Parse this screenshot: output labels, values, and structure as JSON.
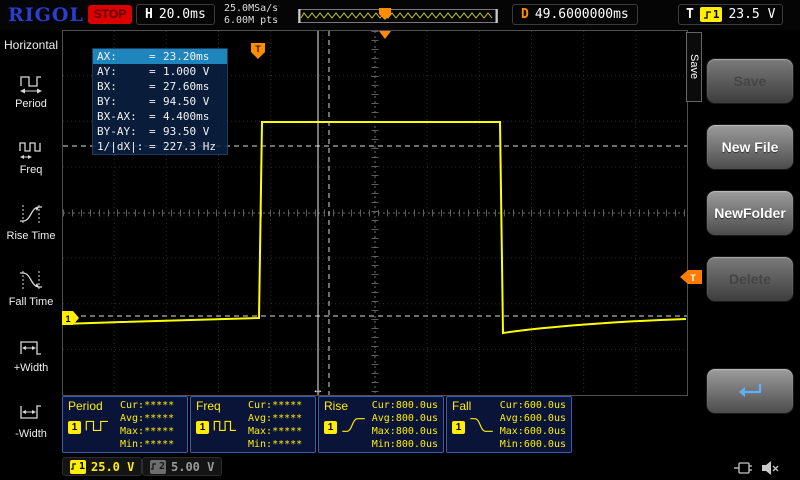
{
  "top_bar": {
    "logo": "RIGOL",
    "run_state": "STOP",
    "horizontal": {
      "label": "H",
      "timebase": "20.0ms"
    },
    "acquisition": {
      "sample_rate": "25.0MSa/s",
      "memory_depth": "6.00M pts"
    },
    "delay": {
      "label": "D",
      "value": "49.6000000ms"
    },
    "trigger": {
      "label": "T",
      "source": "1",
      "level": "23.5 V"
    }
  },
  "left_menu": {
    "title": "Horizontal",
    "items": [
      {
        "label": "Period"
      },
      {
        "label": "Freq"
      },
      {
        "label": "Rise Time"
      },
      {
        "label": "Fall Time"
      },
      {
        "label": "+Width"
      },
      {
        "label": "-Width"
      }
    ]
  },
  "cursor_panel": {
    "equals": "=",
    "rows": [
      {
        "label": "AX:",
        "value": "23.20ms"
      },
      {
        "label": "AY:",
        "value": "1.000 V"
      },
      {
        "label": "BX:",
        "value": "27.60ms"
      },
      {
        "label": "BY:",
        "value": "94.50 V"
      },
      {
        "label": "BX-AX:",
        "value": "4.400ms"
      },
      {
        "label": "BY-AY:",
        "value": "93.50 V"
      },
      {
        "label": "1/|dX|:",
        "value": "227.3 Hz"
      }
    ]
  },
  "right_menu": {
    "tab_label": "Save",
    "buttons": [
      {
        "label": "Save",
        "enabled": false
      },
      {
        "label": "New File",
        "enabled": true
      },
      {
        "label": "NewFolder",
        "enabled": true
      },
      {
        "label": "Delete",
        "enabled": false
      }
    ]
  },
  "measurements": {
    "stat_labels": {
      "cur": "Cur:",
      "avg": "Avg:",
      "max": "Max:",
      "min": "Min:"
    },
    "items": [
      {
        "name": "Period",
        "source": "1",
        "cur": "*****",
        "avg": "*****",
        "max": "*****",
        "min": "*****"
      },
      {
        "name": "Freq",
        "source": "1",
        "cur": "*****",
        "avg": "*****",
        "max": "*****",
        "min": "*****"
      },
      {
        "name": "Rise",
        "source": "1",
        "cur": "800.0us",
        "avg": "800.0us",
        "max": "800.0us",
        "min": "800.0us"
      },
      {
        "name": "Fall",
        "source": "1",
        "cur": "600.0us",
        "avg": "600.0us",
        "max": "600.0us",
        "min": "600.0us"
      }
    ]
  },
  "channel_bar": {
    "ch1": {
      "number": "1",
      "scale": "25.0 V"
    },
    "ch2": {
      "number": "2",
      "scale": "5.00 V"
    }
  },
  "icons": {
    "cursor_drag": "↔"
  },
  "colors": {
    "waveform": "#ffff00",
    "trigger_orange": "#ff8c00",
    "channel1_yellow": "#ffee00",
    "logo_blue": "#2a3ed2",
    "stop_red": "#dd0000"
  }
}
